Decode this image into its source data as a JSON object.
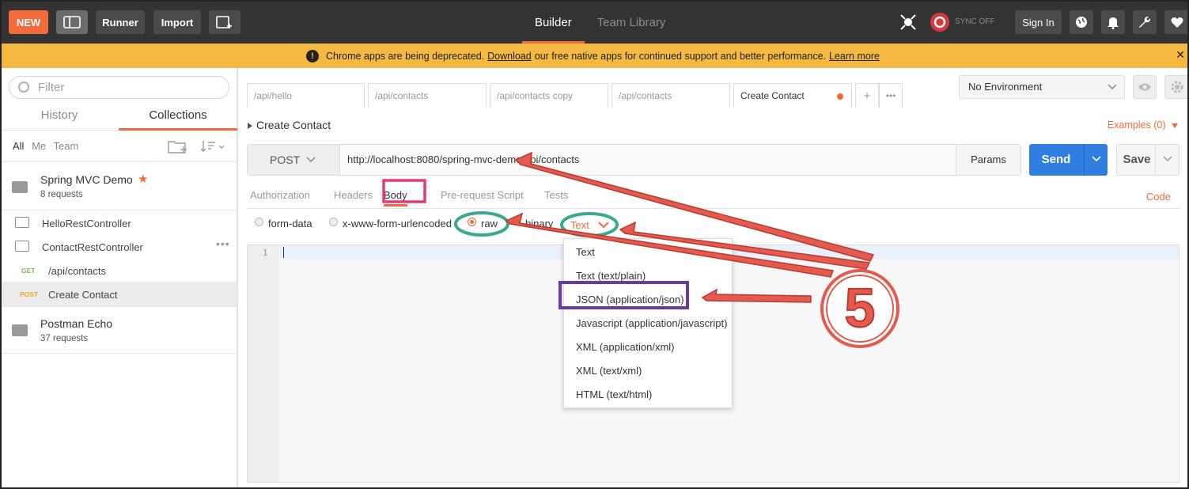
{
  "topbar": {
    "new_label": "NEW",
    "runner_label": "Runner",
    "import_label": "Import",
    "tabs": [
      {
        "label": "Builder"
      },
      {
        "label": "Team Library"
      }
    ],
    "sync_label": "SYNC OFF",
    "signin_label": "Sign In",
    "accent": "#f26b3a"
  },
  "banner": {
    "pre": "Chrome apps are being deprecated.",
    "download": "Download",
    "mid": "our free native apps for continued support and better performance.",
    "learn_more": "Learn more",
    "close": "✕",
    "icon": "!"
  },
  "sidebar": {
    "filter_placeholder": "Filter",
    "tabs": [
      {
        "label": "History"
      },
      {
        "label": "Collections"
      }
    ],
    "scope": [
      "All",
      "Me",
      "Team"
    ],
    "collections": [
      {
        "name": "Spring MVC Demo",
        "sub": "8 requests"
      },
      {
        "name": "Postman Echo",
        "sub": "37 requests"
      }
    ],
    "folders": [
      "HelloRestController",
      "ContactRestController"
    ],
    "requests": [
      {
        "method": "GET",
        "name": "/api/contacts",
        "color": "#7bb84d"
      },
      {
        "method": "POST",
        "name": "Create Contact",
        "color": "#f5a623"
      }
    ],
    "more": "•••"
  },
  "request_tabs": [
    "/api/hello",
    "/api/contacts",
    "/api/contacts copy",
    "/api/contacts",
    "Create Contact"
  ],
  "request_tabs_extra": {
    "add": "+",
    "more": "•••"
  },
  "environment": "No Environment",
  "request": {
    "title": "Create Contact",
    "examples": "Examples (0)",
    "method": "POST",
    "url": "http://localhost:8080/spring-mvc-demo/api/contacts",
    "params": "Params",
    "send": "Send",
    "save": "Save"
  },
  "req_section_tabs": [
    "Authorization",
    "Headers",
    "Body",
    "Pre-request Script",
    "Tests"
  ],
  "code_link": "Code",
  "body_modes": [
    "form-data",
    "x-www-form-urlencoded",
    "raw",
    "binary"
  ],
  "raw_type": "Text",
  "editor": {
    "line": "1"
  },
  "content_types": [
    "Text",
    "Text (text/plain)",
    "JSON (application/json)",
    "Javascript (application/javascript)",
    "XML (application/xml)",
    "XML (text/xml)",
    "HTML (text/html)"
  ],
  "annotation": {
    "step": "5",
    "arrow_color": "#e55a4e",
    "highlight_pink": "#e8387a",
    "highlight_teal": "#3aa98e",
    "highlight_purple": "#6b3aa0"
  }
}
